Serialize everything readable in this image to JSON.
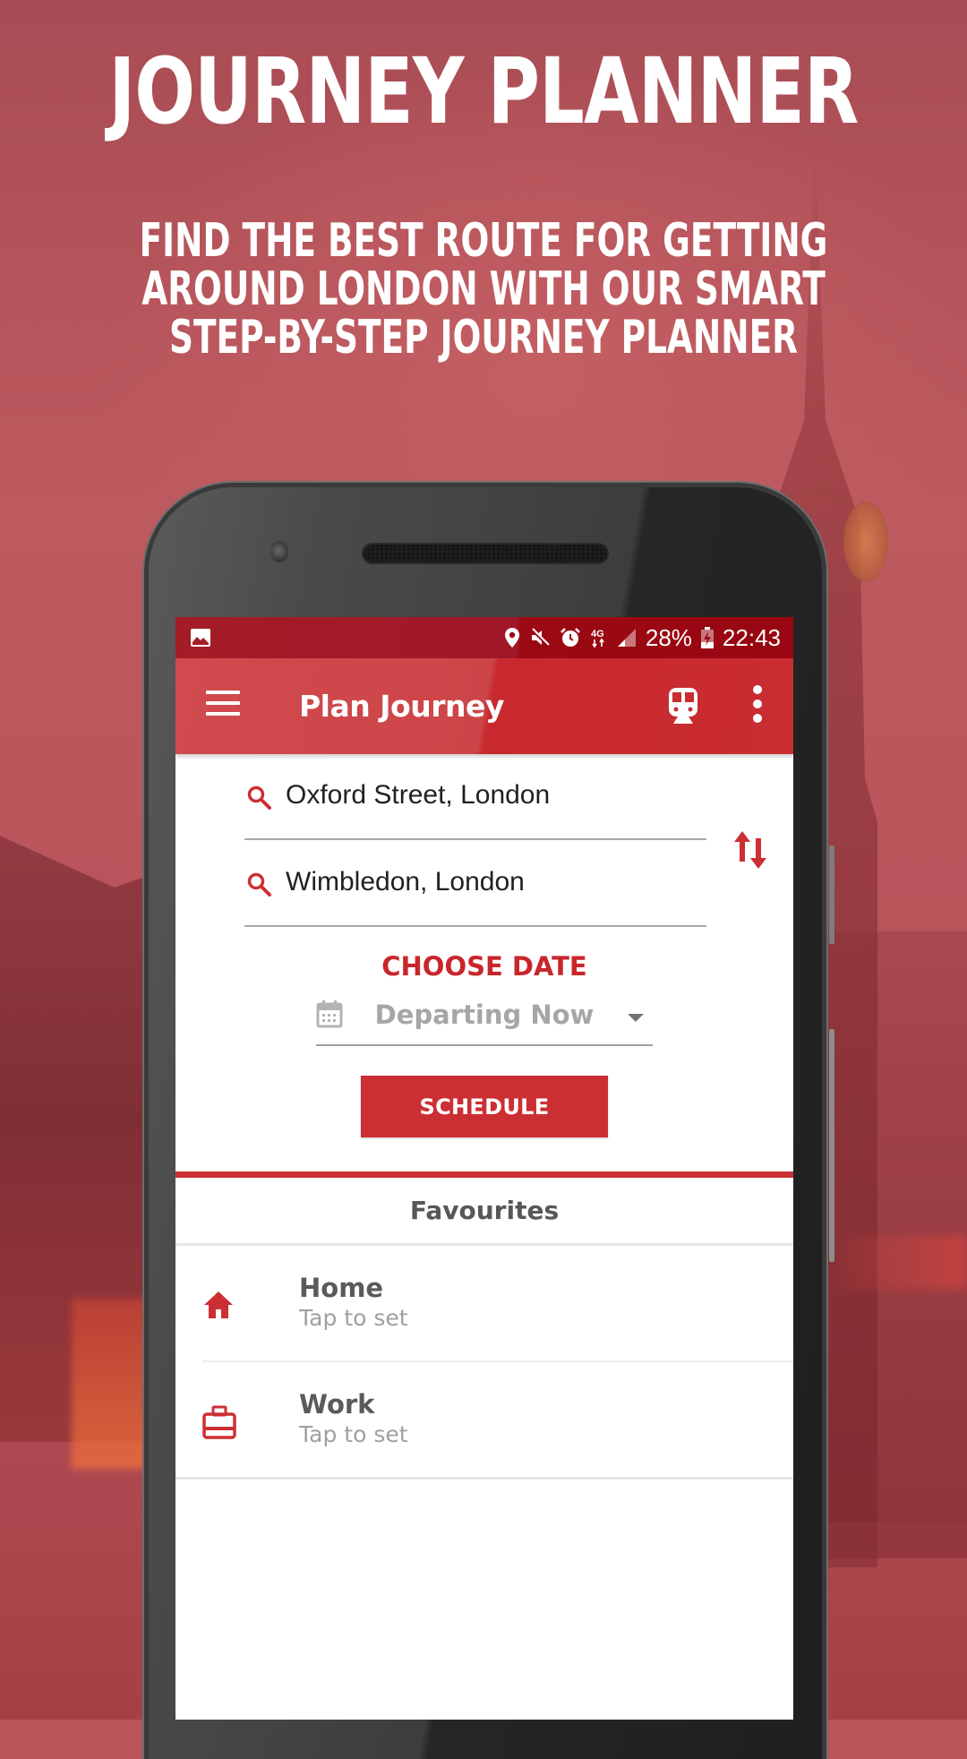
{
  "hero": {
    "title": "JOURNEY PLANNER",
    "subtitle_lines": [
      "FIND THE BEST ROUTE FOR GETTING",
      "AROUND LONDON WITH OUR SMART",
      "STEP-BY-STEP JOURNEY PLANNER"
    ]
  },
  "status_bar": {
    "left_icons": [
      "image-notification-icon"
    ],
    "right_icons": [
      "location-icon",
      "mute-icon",
      "alarm-icon",
      "4g-data-icon",
      "signal-icon"
    ],
    "battery_percent": "28%",
    "battery_icon": "battery-charging-icon",
    "time": "22:43"
  },
  "app_bar": {
    "menu_icon": "hamburger-menu-icon",
    "title": "Plan Journey",
    "actions": [
      {
        "icon": "train-icon",
        "label": "Transport modes"
      },
      {
        "icon": "more-vert-icon",
        "label": "More options"
      }
    ]
  },
  "journey_form": {
    "from": {
      "value": "Oxford Street, London",
      "icon": "search-icon"
    },
    "to": {
      "value": "Wimbledon, London",
      "icon": "search-icon"
    },
    "swap_icon": "swap-vertical-icon",
    "choose_date_label": "CHOOSE DATE",
    "date_select": {
      "icon": "calendar-icon",
      "selected": "Departing Now"
    },
    "schedule_label": "SCHEDULE"
  },
  "favourites": {
    "header": "Favourites",
    "items": [
      {
        "name": "Home",
        "subtitle": "Tap to set",
        "icon": "home-icon"
      },
      {
        "name": "Work",
        "subtitle": "Tap to set",
        "icon": "briefcase-icon"
      }
    ]
  },
  "colors": {
    "brand_red": "#cc2f33",
    "status_bar_red": "#9b0a13",
    "text_dark": "#212121",
    "text_muted": "#a0a0a0"
  }
}
